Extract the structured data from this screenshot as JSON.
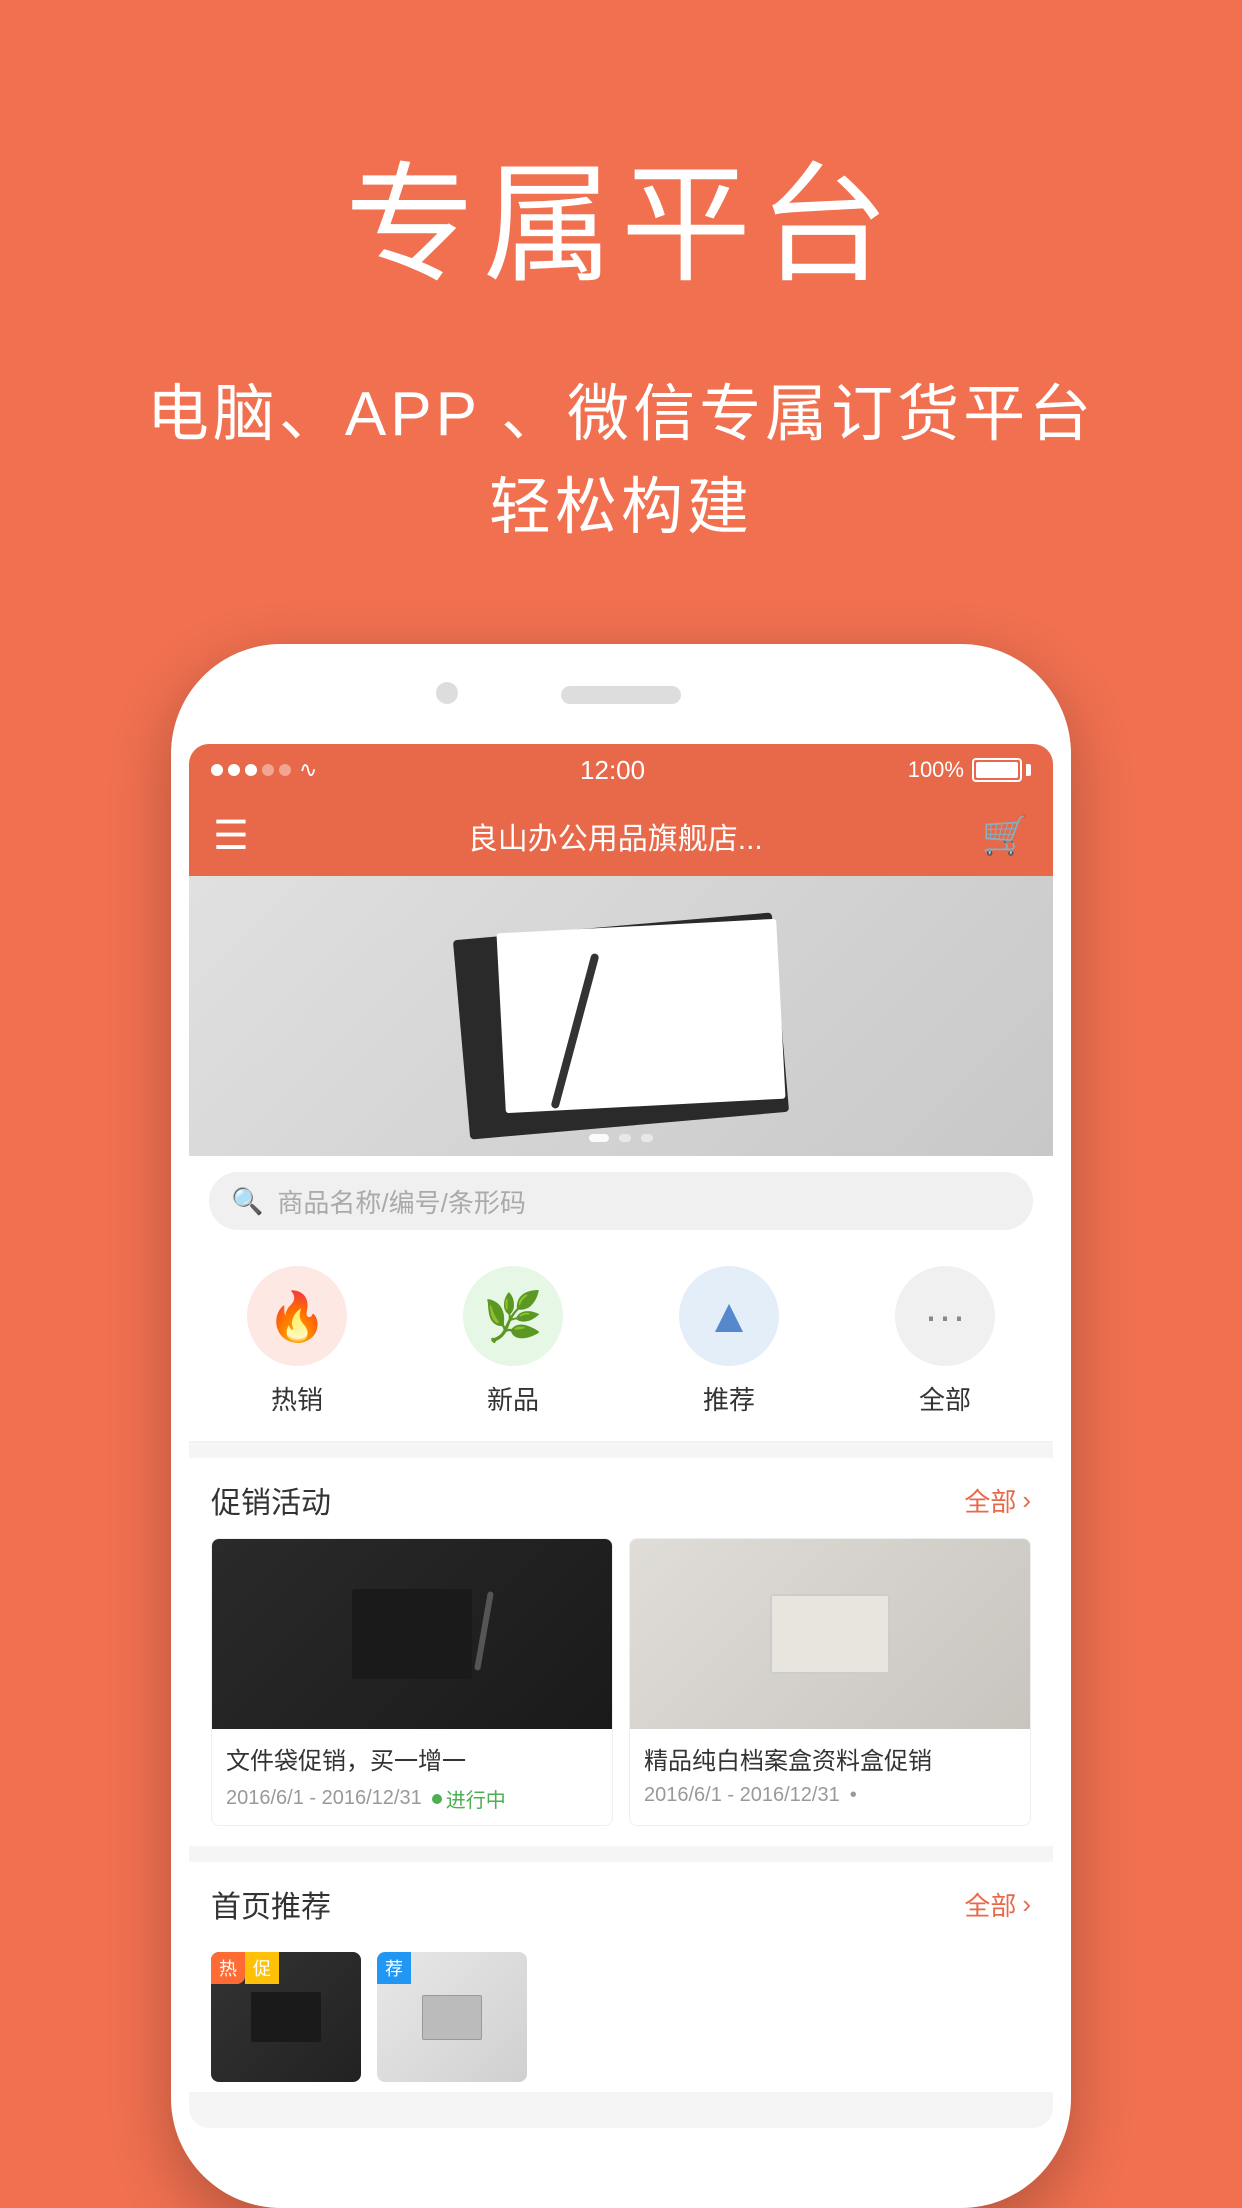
{
  "page": {
    "background_color": "#F07050"
  },
  "header": {
    "main_title": "专属平台",
    "sub_title_line1": "电脑、APP 、微信专属订货平台",
    "sub_title_line2": "轻松构建"
  },
  "phone": {
    "status_bar": {
      "time": "12:00",
      "battery": "100%"
    },
    "app_bar": {
      "store_name": "良山办公用品旗舰店..."
    },
    "search": {
      "placeholder": "商品名称/编号/条形码"
    },
    "categories": [
      {
        "label": "热销",
        "icon": "🔥",
        "color_class": "cat-hot"
      },
      {
        "label": "新品",
        "icon": "🌿",
        "color_class": "cat-new"
      },
      {
        "label": "推荐",
        "icon": "△",
        "color_class": "cat-rec"
      },
      {
        "label": "全部",
        "icon": "···",
        "color_class": "cat-all"
      }
    ],
    "promo_section": {
      "title": "促销活动",
      "more_text": "全部",
      "items": [
        {
          "title": "文件袋促销，买一增一",
          "date": "2016/6/1 - 2016/12/31",
          "status": "进行中",
          "type": "dark"
        },
        {
          "title": "精品纯白档案盒资料盒促销",
          "date": "2016/6/1 - 2016/12/31",
          "status": "•",
          "type": "light"
        }
      ]
    },
    "home_rec": {
      "title": "首页推荐",
      "more_text": "全部",
      "tags": [
        {
          "label": "热",
          "color": "hot"
        },
        {
          "label": "促",
          "color": "promo"
        },
        {
          "label": "荐",
          "color": "blue"
        }
      ]
    }
  }
}
